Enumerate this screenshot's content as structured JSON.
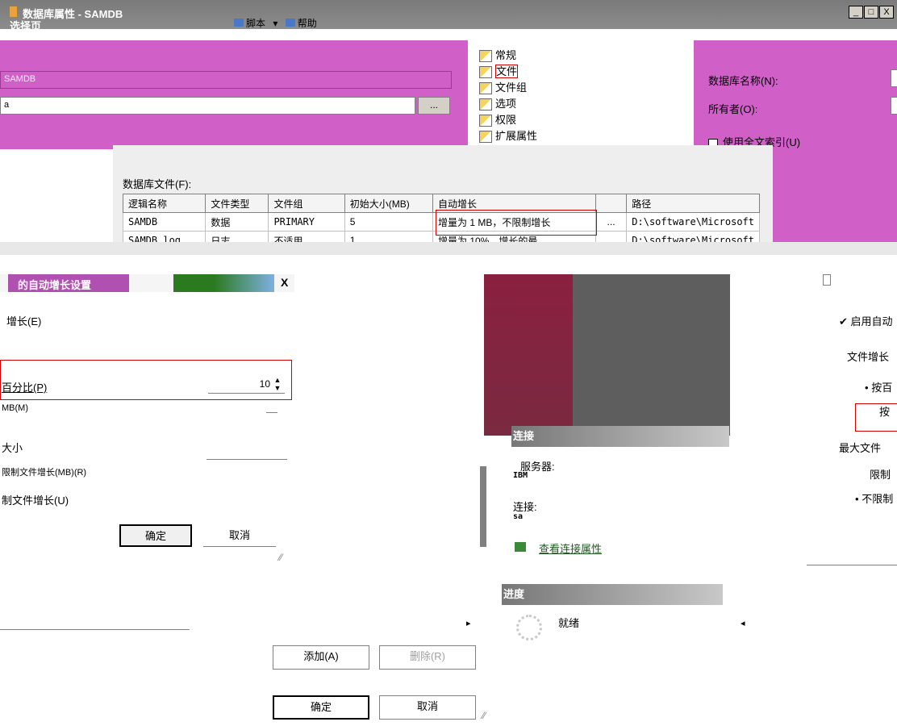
{
  "window": {
    "title": "数据库属性 - SAMDB",
    "select_page": "选择页",
    "minimize": "_",
    "maximize": "□",
    "close": "X"
  },
  "toolbar": {
    "script_label": "脚本",
    "help_label": "帮助"
  },
  "general": {
    "db_name_value": "SAMDB",
    "owner_value": "a",
    "browse_label": "...",
    "db_name_label": "数据库名称(N):",
    "owner_label": "所有者(O):",
    "fulltext_label": "使用全文索引(U)"
  },
  "page_tree": {
    "items": [
      "常规",
      "文件",
      "文件组",
      "选项",
      "权限",
      "扩展属性"
    ],
    "selected_index": 1
  },
  "files": {
    "label": "数据库文件(F):",
    "columns": [
      "逻辑名称",
      "文件类型",
      "文件组",
      "初始大小(MB)",
      "自动增长",
      "",
      "路径"
    ],
    "rows": [
      [
        "SAMDB",
        "数据",
        "PRIMARY",
        "5",
        "增量为 1 MB，不限制增长",
        "...",
        "D:\\software\\Microsoft"
      ],
      [
        "SAMDB_log",
        "日志",
        "不适用",
        "1",
        "增量为 10%，增长的最",
        "...",
        "D:\\software\\Microsoft"
      ]
    ]
  },
  "autogrow_dialog": {
    "title": "的自动增长设置",
    "close": "X",
    "enable_label": "增长(E)",
    "percent_label": "百分比(P)",
    "percent_value": "10",
    "mb_label": "MB(M)",
    "max_size_label": "大小",
    "limit_label": "限制文件增长(MB)(R)",
    "unlimited_label": "制文件增长(U)",
    "ok": "确定",
    "cancel": "取消"
  },
  "connection": {
    "header": "连接",
    "server_label": "服务器:",
    "server_value": "IBM",
    "connection_label": "连接:",
    "connection_value": "sa",
    "view_link": "查看连接属性",
    "progress_header": "进度",
    "progress_status": "就绪"
  },
  "right_dialog": {
    "enable_label": "启用自动",
    "file_growth_label": "文件增长",
    "by_percent_label": "按百",
    "by_mb_label": "按",
    "max_size_label": "最大文件",
    "limit_label": "限制",
    "unlimited_label": "不限制"
  },
  "bottom": {
    "add": "添加(A)",
    "remove": "删除(R)",
    "ok": "确定",
    "cancel": "取消"
  }
}
